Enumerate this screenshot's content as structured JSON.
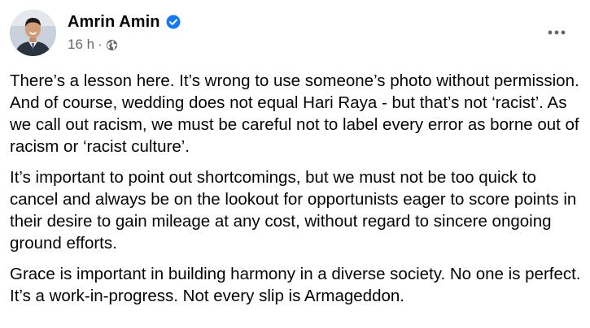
{
  "post": {
    "author": "Amrin Amin",
    "verified_icon": "verified-badge-icon",
    "timestamp": "16 h",
    "separator": "·",
    "audience_icon": "globe-icon",
    "more_icon": "more-options-icon",
    "colors": {
      "verified": "#1877f2",
      "meta_text": "#65676b",
      "body_text": "#050505"
    },
    "paragraphs": [
      "There’s a lesson here. It’s wrong to use someone’s photo without permission. And of course, wedding does not equal Hari Raya - but that’s not ‘racist’. As we call out racism, we must be careful not to label every error as borne out of racism or ‘racist culture’.",
      "It’s important to point out shortcomings, but we must not be too quick to cancel and always be on the lookout for opportunists eager to score points in their desire to gain mileage at any cost, without regard to sincere ongoing ground efforts.",
      "Grace is important in building harmony in a diverse society. No one is perfect. It’s a work-in-progress. Not every slip is Armageddon."
    ]
  }
}
